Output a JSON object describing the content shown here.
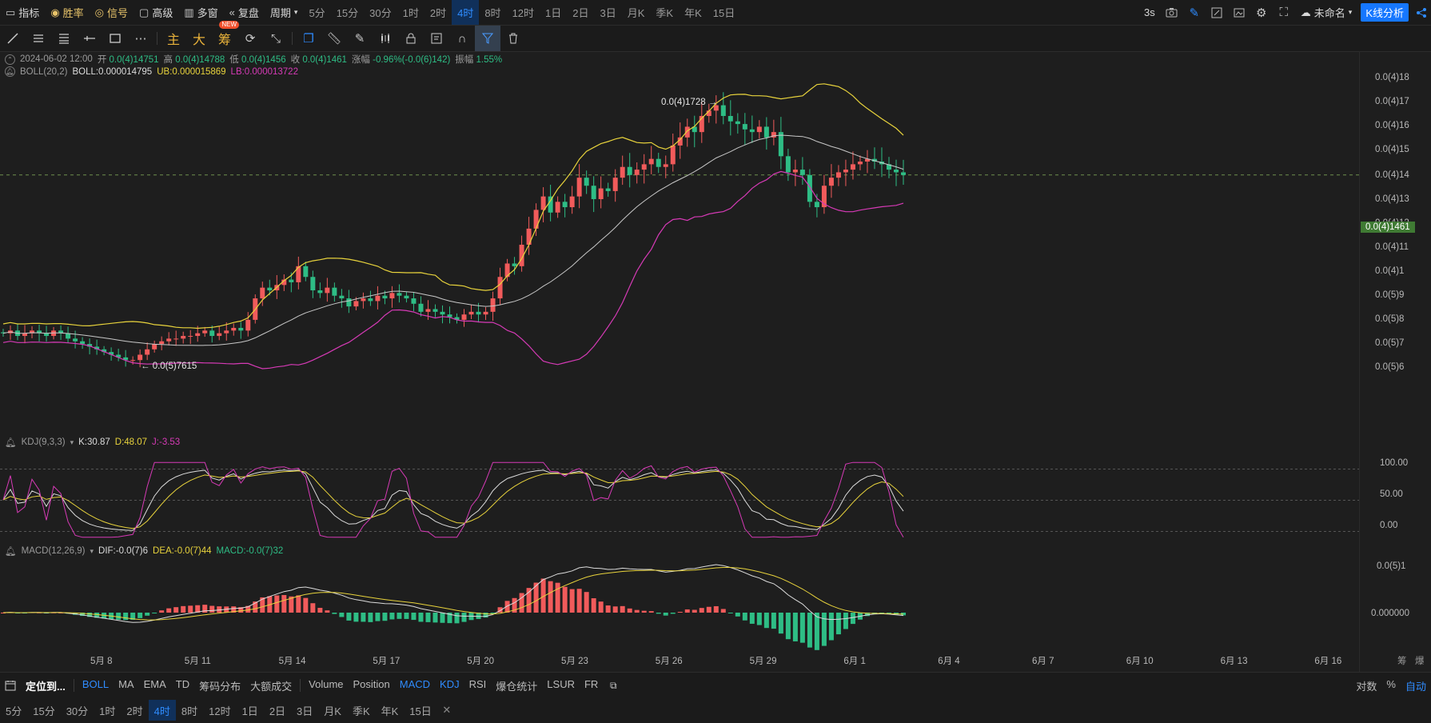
{
  "topbar": {
    "left_items": [
      {
        "icon": "indicator-icon",
        "label": "指标"
      },
      {
        "icon": "winrate-icon",
        "label": "胜率"
      },
      {
        "icon": "signal-icon",
        "label": "信号"
      },
      {
        "icon": "advanced-icon",
        "label": "高级"
      },
      {
        "icon": "multi-window-icon",
        "label": "多窗"
      },
      {
        "icon": "replay-icon",
        "label": "复盘"
      }
    ],
    "period_label": "周期",
    "periods": [
      "5分",
      "15分",
      "30分",
      "1时",
      "2时",
      "4时",
      "8时",
      "12时",
      "1日",
      "2日",
      "3日",
      "月K",
      "季K",
      "年K",
      "15日"
    ],
    "active_period": "4时",
    "refresh_label": "3s",
    "layout_name": "未命名",
    "analysis_button": "K线分析",
    "accent": "#2f8cff"
  },
  "toolbar": {
    "tools": [
      "trend-line-icon",
      "parallel-lines-icon",
      "horizontal-lines-icon",
      "ray-icon",
      "rectangle-icon",
      "more-icon"
    ],
    "zh_tools": [
      {
        "label": "主",
        "new": false
      },
      {
        "label": "大",
        "new": false
      },
      {
        "label": "筹",
        "new": true
      }
    ],
    "new_badge": "NEW"
  },
  "legend": {
    "date": "2024-06-02 12:00",
    "open_label": "开",
    "open": "0.0(4)14751",
    "high_label": "高",
    "high": "0.0(4)14788",
    "low_label": "低",
    "low": "0.0(4)1456",
    "close_label": "收",
    "close": "0.0(4)1461",
    "change_label": "涨幅",
    "change": "-0.96%(-0.0(6)142)",
    "amp_label": "振幅",
    "amp": "1.55%",
    "boll_name": "BOLL(20,2)",
    "boll": "BOLL:0.000014795",
    "ub": "UB:0.000015869",
    "lb": "LB:0.000013722",
    "kdj_name": "KDJ(9,3,3)",
    "k": "K:30.87",
    "d": "D:48.07",
    "j": "J:-3.53",
    "macd_name": "MACD(12,26,9)",
    "dif": "DIF:-0.0(7)6",
    "dea": "DEA:-0.0(7)44",
    "macd": "MACD:-0.0(7)32"
  },
  "annotations": {
    "high_mark": "0.0(4)1728 →",
    "low_mark": "← 0.0(5)7615"
  },
  "price_axis": [
    "0.0(4)18",
    "0.0(4)17",
    "0.0(4)16",
    "0.0(4)15",
    "0.0(4)14",
    "0.0(4)13",
    "0.0(4)12",
    "0.0(4)11",
    "0.0(4)1",
    "0.0(5)9",
    "0.0(5)8",
    "0.0(5)7",
    "0.0(5)6"
  ],
  "current_price": "0.0(4)1461",
  "kdj_axis": [
    "100.00",
    "50.00",
    "0.00"
  ],
  "macd_axis": [
    "0.0(5)1",
    "0.000000"
  ],
  "date_axis": [
    "5月 8",
    "5月 11",
    "5月 14",
    "5月 17",
    "5月 20",
    "5月 23",
    "5月 26",
    "5月 29",
    "6月 1",
    "6月 4",
    "6月 7",
    "6月 10",
    "6月 13",
    "6月 16"
  ],
  "corner_labels": [
    "筹",
    "爆"
  ],
  "bottom": {
    "locate_label": "定位到...",
    "indicators": [
      {
        "label": "BOLL",
        "on": true
      },
      {
        "label": "MA",
        "on": false
      },
      {
        "label": "EMA",
        "on": false
      },
      {
        "label": "TD",
        "on": false
      },
      {
        "label": "筹码分布",
        "on": false
      },
      {
        "label": "大额成交",
        "on": false
      }
    ],
    "sub_indicators": [
      {
        "label": "Volume",
        "on": false
      },
      {
        "label": "Position",
        "on": false
      },
      {
        "label": "MACD",
        "on": true
      },
      {
        "label": "KDJ",
        "on": true
      },
      {
        "label": "RSI",
        "on": false
      },
      {
        "label": "爆仓统计",
        "on": false
      },
      {
        "label": "LSUR",
        "on": false
      },
      {
        "label": "FR",
        "on": false
      }
    ],
    "right_options": [
      "对数",
      "%",
      "自动"
    ],
    "periods": [
      "5分",
      "15分",
      "30分",
      "1时",
      "2时",
      "4时",
      "8时",
      "12时",
      "1日",
      "2日",
      "3日",
      "月K",
      "季K",
      "年K",
      "15日"
    ],
    "active_period": "4时"
  },
  "colors": {
    "up": "#f15b5b",
    "down": "#2ebd85",
    "boll_mid": "#c8c8c8",
    "boll_ub": "#e8d33c",
    "boll_lb": "#d63ab6"
  },
  "chart_data": {
    "type": "candlestick",
    "interval": "4h",
    "x_start": "5月 6",
    "x_end": "6月 2",
    "y_scale": "price",
    "ylim": [
      5.5e-06,
      1.85e-05
    ],
    "close_series": [
      8.7e-06,
      8.8e-06,
      8.6e-06,
      8.7e-06,
      8.8e-06,
      8.7e-06,
      8.6e-06,
      8.8e-06,
      8.7e-06,
      8.5e-06,
      8.4e-06,
      8.3e-06,
      8.2e-06,
      8.1e-06,
      8e-06,
      7.9e-06,
      7.8e-06,
      7.7e-06,
      7.7e-06,
      7.9e-06,
      8.1e-06,
      8.3e-06,
      8.4e-06,
      8.5e-06,
      8.5e-06,
      8.6e-06,
      8.6e-06,
      8.7e-06,
      8.8e-06,
      8.6e-06,
      8.7e-06,
      8.8e-06,
      8.9e-06,
      8.8e-06,
      9.2e-06,
      1e-05,
      1.04e-05,
      1.03e-05,
      1.05e-05,
      1.07e-05,
      1.06e-05,
      1.12e-05,
      1.08e-05,
      1.03e-05,
      1.02e-05,
      1.04e-05,
      1.01e-05,
      1e-05,
      9.7e-06,
      9.9e-06,
      1e-05,
      9.9e-06,
      1.01e-05,
      1e-05,
      1.02e-05,
      1.01e-05,
      1e-05,
      9.8e-06,
      9.5e-06,
      9.6e-06,
      9.5e-06,
      9.4e-06,
      9.3e-06,
      9.2e-06,
      9.4e-06,
      9.5e-06,
      9.4e-06,
      9.5e-06,
      1e-05,
      1.08e-05,
      1.13e-05,
      1.12e-05,
      1.2e-05,
      1.26e-05,
      1.33e-05,
      1.38e-05,
      1.32e-05,
      1.36e-05,
      1.34e-05,
      1.38e-05,
      1.45e-05,
      1.42e-05,
      1.37e-05,
      1.41e-05,
      1.4e-05,
      1.45e-05,
      1.49e-05,
      1.46e-05,
      1.48e-05,
      1.5e-05,
      1.52e-05,
      1.49e-05,
      1.5e-05,
      1.57e-05,
      1.6e-05,
      1.64e-05,
      1.62e-05,
      1.68e-05,
      1.7e-05,
      1.72e-05,
      1.68e-05,
      1.66e-05,
      1.65e-05,
      1.63e-05,
      1.62e-05,
      1.64e-05,
      1.6e-05,
      1.62e-05,
      1.53e-05,
      1.47e-05,
      1.48e-05,
      1.46e-05,
      1.36e-05,
      1.34e-05,
      1.42e-05,
      1.45e-05,
      1.47e-05,
      1.48e-05,
      1.5e-05,
      1.51e-05,
      1.52e-05,
      1.51e-05,
      1.5e-05,
      1.48e-05,
      1.47e-05,
      1.46e-05
    ],
    "kdj": {
      "k": 30.87,
      "d": 48.07,
      "j": -3.53
    },
    "macd": {
      "dif": "-0.0(7)6",
      "dea": "-0.0(7)44",
      "macd": "-0.0(7)32"
    }
  }
}
